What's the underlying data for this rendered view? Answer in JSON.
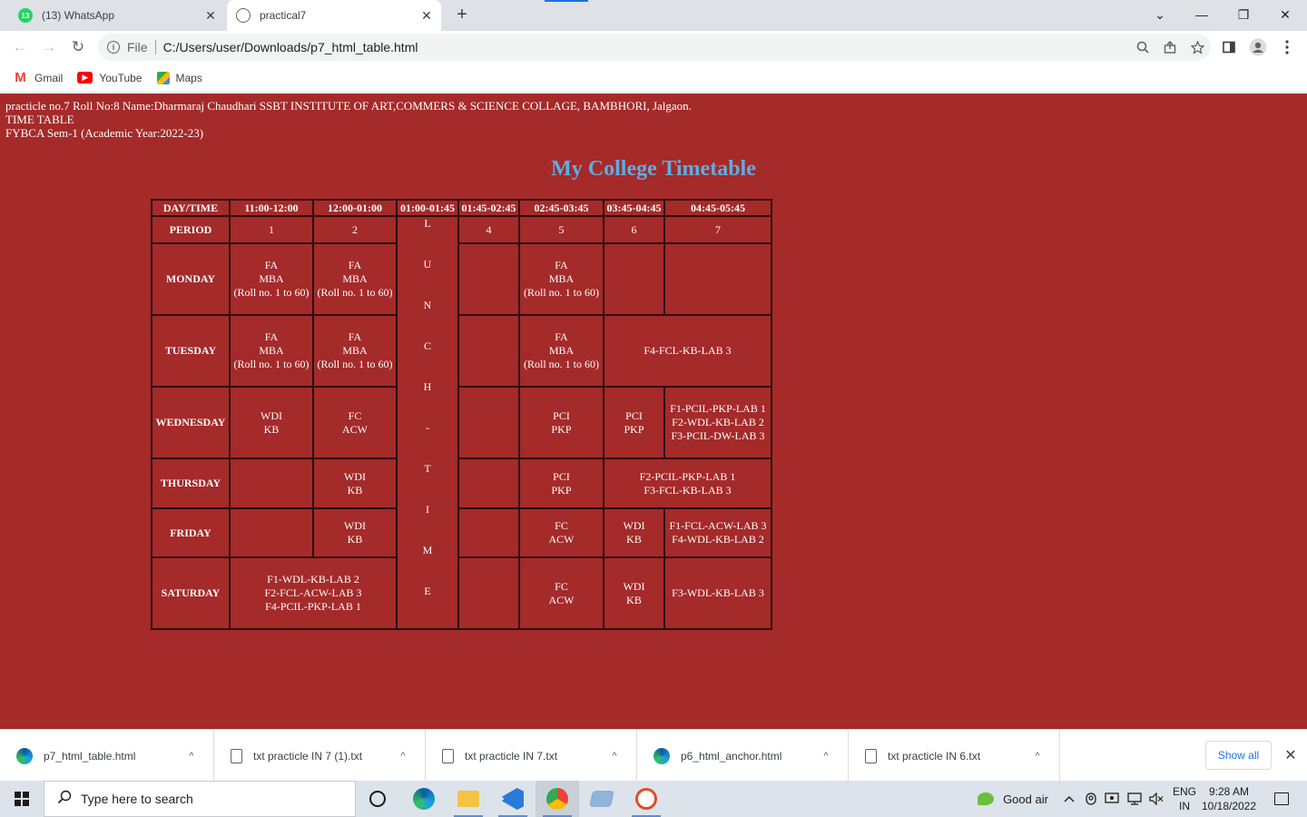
{
  "browser": {
    "tabs": [
      {
        "title": "(13) WhatsApp",
        "badge": "13",
        "close": "✕"
      },
      {
        "title": "practical7",
        "close": "✕"
      }
    ],
    "new_tab": "+",
    "window_controls": {
      "chevron": "⌄",
      "minimize": "—",
      "restore": "❐",
      "close": "✕"
    },
    "nav": {
      "back": "←",
      "forward": "→",
      "reload": "↻"
    },
    "address": {
      "info": "i",
      "scheme": "File",
      "url": "C:/Users/user/Downloads/p7_html_table.html"
    },
    "bookmarks": [
      {
        "label": "Gmail",
        "icon": "gmail-icon"
      },
      {
        "label": "YouTube",
        "icon": "youtube-icon"
      },
      {
        "label": "Maps",
        "icon": "maps-icon"
      }
    ]
  },
  "page": {
    "intro_line1": "practicle no.7 Roll No:8 Name:Dharmaraj Chaudhari SSBT INSTITUTE OF ART,COMMERS & SCIENCE COLLAGE, BAMBHORI, Jalgaon.",
    "intro_line2": "TIME TABLE",
    "intro_line3": "FYBCA Sem-1 (Academic Year:2022-23)",
    "heading": "My College Timetable",
    "table": {
      "header_day": "DAY/TIME",
      "times": [
        "11:00-12:00",
        "12:00-01:00",
        "01:00-01:45",
        "01:45-02:45",
        "02:45-03:45",
        "03:45-04:45",
        "04:45-05:45"
      ],
      "period_label": "PERIOD",
      "periods": [
        "1",
        "2",
        "4",
        "5",
        "6",
        "7"
      ],
      "lunch_letters": [
        "L",
        "U",
        "N",
        "C",
        "H",
        "-",
        "T",
        "I",
        "M",
        "E"
      ],
      "days": [
        "MONDAY",
        "TUESDAY",
        "WEDNESDAY",
        "THURSDAY",
        "FRIDAY",
        "SATURDAY"
      ],
      "monday": {
        "p1": [
          "FA",
          "MBA",
          "(Roll no. 1 to 60)"
        ],
        "p2": [
          "FA",
          "MBA",
          "(Roll no. 1 to 60)"
        ],
        "p5": [
          "FA",
          "MBA",
          "(Roll no. 1 to 60)"
        ]
      },
      "tuesday": {
        "p1": [
          "FA",
          "MBA",
          "(Roll no. 1 to 60)"
        ],
        "p2": [
          "FA",
          "MBA",
          "(Roll no. 1 to 60)"
        ],
        "p5": [
          "FA",
          "MBA",
          "(Roll no. 1 to 60)"
        ],
        "p67": [
          "F4-FCL-KB-LAB 3"
        ]
      },
      "wednesday": {
        "p1": [
          "WDI",
          "KB"
        ],
        "p2": [
          "FC",
          "ACW"
        ],
        "p5": [
          "PCI",
          "PKP"
        ],
        "p6": [
          "PCI",
          "PKP"
        ],
        "p7": [
          "F1-PCIL-PKP-LAB 1",
          "F2-WDL-KB-LAB 2",
          "F3-PCIL-DW-LAB 3"
        ]
      },
      "thursday": {
        "p2": [
          "WDI",
          "KB"
        ],
        "p5": [
          "PCI",
          "PKP"
        ],
        "p67": [
          "F2-PCIL-PKP-LAB 1",
          "F3-FCL-KB-LAB 3"
        ]
      },
      "friday": {
        "p2": [
          "WDI",
          "KB"
        ],
        "p5": [
          "FC",
          "ACW"
        ],
        "p6": [
          "WDI",
          "KB"
        ],
        "p7": [
          "F1-FCL-ACW-LAB 3",
          "F4-WDL-KB-LAB 2"
        ]
      },
      "saturday": {
        "p12": [
          "F1-WDL-KB-LAB 2",
          "F2-FCL-ACW-LAB 3",
          "F4-PCIL-PKP-LAB 1"
        ],
        "p5": [
          "FC",
          "ACW"
        ],
        "p6": [
          "WDI",
          "KB"
        ],
        "p7": [
          "F3-WDL-KB-LAB 3"
        ]
      }
    }
  },
  "downloads": {
    "items": [
      {
        "name": "p7_html_table.html",
        "icon": "edge-file-icon"
      },
      {
        "name": "txt practicle IN 7 (1).txt",
        "icon": "text-file-icon"
      },
      {
        "name": "txt practicle IN 7.txt",
        "icon": "text-file-icon"
      },
      {
        "name": "p6_html_anchor.html",
        "icon": "edge-file-icon"
      },
      {
        "name": "txt practicle IN 6.txt",
        "icon": "text-file-icon"
      }
    ],
    "chevron": "^",
    "show_all": "Show all",
    "close": "✕"
  },
  "taskbar": {
    "search_placeholder": "Type here to search",
    "weather": "Good air",
    "lang_line1": "ENG",
    "lang_line2": "IN",
    "time": "9:28 AM",
    "date": "10/18/2022",
    "colors": {
      "edge": "#1ba1e2",
      "explorer": "#f5c242",
      "vscode": "#2a7bd8",
      "chrome": "#34a853",
      "app5": "#8fb3d9",
      "app6": "#e24a2d"
    }
  },
  "colors": {
    "page_bg": "#a52a2a",
    "heading": "#5dade2",
    "border": "#2c0e0e"
  }
}
